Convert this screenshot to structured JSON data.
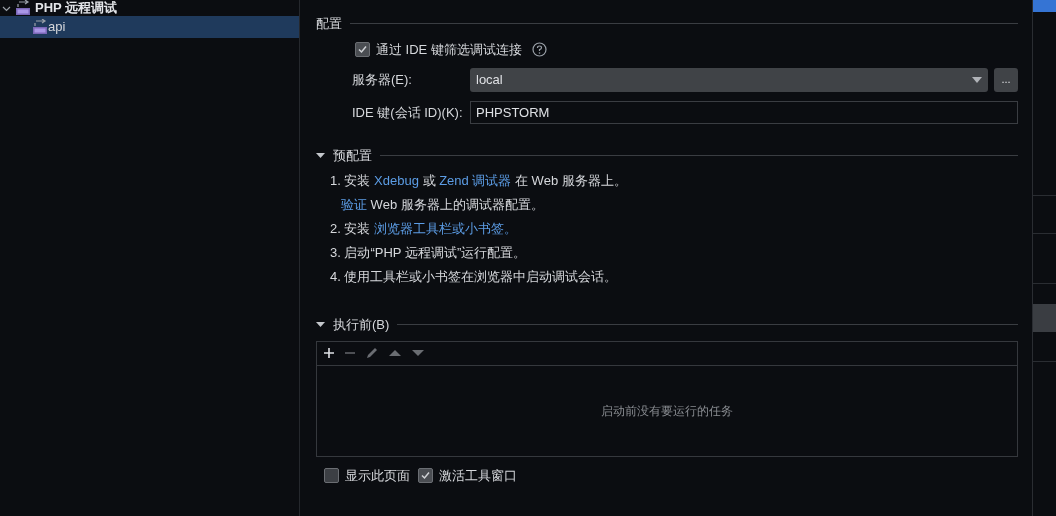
{
  "tree": [
    {
      "label": "PHP 远程调试",
      "expanded": true,
      "selected": false,
      "children": [
        {
          "label": "api",
          "selected": true
        }
      ]
    }
  ],
  "config": {
    "title": "配置",
    "filter_checkbox": {
      "label": "通过 IDE 键筛选调试连接",
      "checked": true
    },
    "server": {
      "label": "服务器(E):",
      "value": "local",
      "button": "..."
    },
    "ide_key": {
      "label": "IDE 键(会话 ID)(K):",
      "value": "PHPSTORM"
    }
  },
  "preconfig": {
    "title": "预配置",
    "expanded": true,
    "steps": [
      [
        {
          "text": "1. 安装 ",
          "link": false
        },
        {
          "text": "Xdebug",
          "link": true
        },
        {
          "text": " 或 ",
          "link": false
        },
        {
          "text": "Zend 调试器",
          "link": true
        },
        {
          "text": " 在 Web 服务器上。",
          "link": false
        }
      ],
      [
        {
          "text": "验证",
          "link": true
        },
        {
          "text": " Web 服务器上的调试器配置。",
          "link": false
        }
      ],
      [
        {
          "text": "2. 安装 ",
          "link": false
        },
        {
          "text": "浏览器工具栏或小书签。",
          "link": true
        }
      ],
      [
        {
          "text": "3. 启动“PHP 远程调试”运行配置。",
          "link": false
        }
      ],
      [
        {
          "text": "4. 使用工具栏或小书签在浏览器中启动调试会话。",
          "link": false
        }
      ]
    ]
  },
  "before_launch": {
    "title": "执行前(B)",
    "expanded": true,
    "empty_text": "启动前没有要运行的任务"
  },
  "options": [
    {
      "label": "显示此页面",
      "checked": false
    },
    {
      "label": "激活工具窗口",
      "checked": true
    }
  ]
}
